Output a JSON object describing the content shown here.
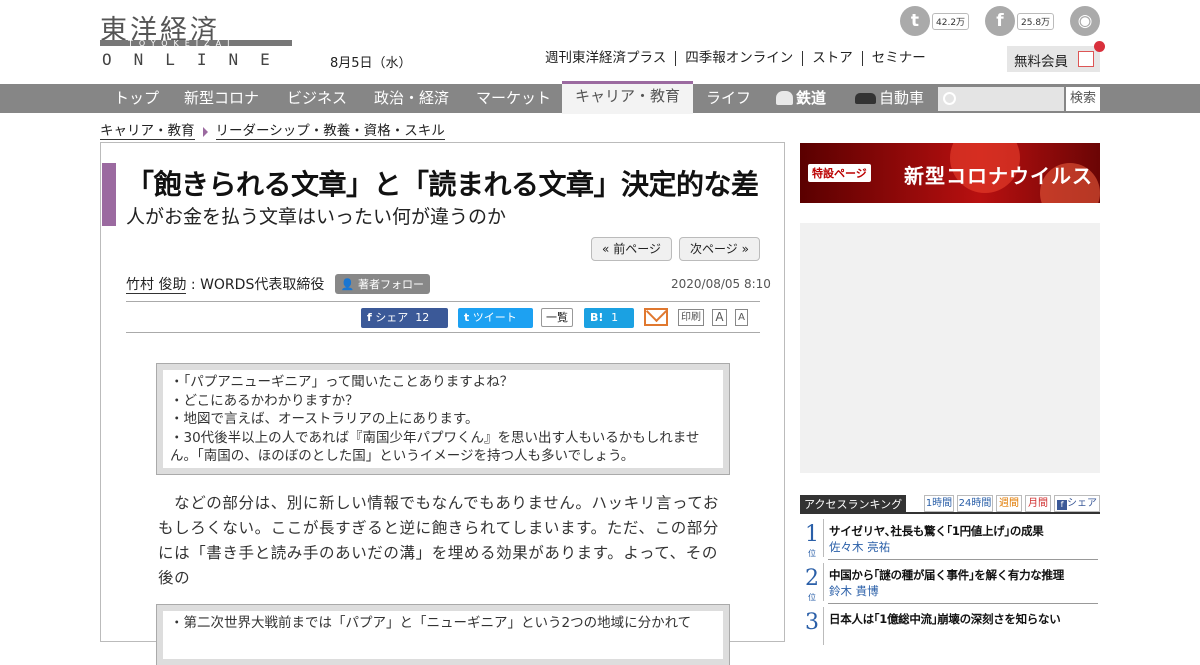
{
  "logo": {
    "jp": "東洋経済",
    "sub": "TOYOKEIZAI",
    "en": "ONLINE"
  },
  "date": "8月5日（水）",
  "social": {
    "twitter_count": "42.2万",
    "facebook_count": "25.8万"
  },
  "top_links": [
    "週刊東洋経済プラス",
    "四季報オンライン",
    "ストア",
    "セミナー"
  ],
  "member_label": "無料会員",
  "nav": {
    "items": [
      "トップ",
      "新型コロナ",
      "ビジネス",
      "政治・経済",
      "マーケット",
      "キャリア・教育",
      "ライフ",
      "鉄道",
      "自動車"
    ],
    "active": "キャリア・教育",
    "search_button": "検索"
  },
  "breadcrumb": [
    "キャリア・教育",
    "リーダーシップ・教養・資格・スキル"
  ],
  "article": {
    "title": "「飽きられる文章」と「読まれる文章」決定的な差",
    "subtitle": "人がお金を払う文章はいったい何が違うのか",
    "prev": "« 前ページ",
    "next": "次ページ »",
    "author_name": "竹村 俊助",
    "author_role": " : WORDS代表取締役",
    "follow_label": "著者フォロー",
    "pubdate": "2020/08/05 8:10",
    "share_fb": "シェア",
    "share_fb_count": "12",
    "share_tw": "ツイート",
    "list_label": "一覧",
    "hatena": "B!",
    "hatena_count": "1",
    "print_label": "印刷",
    "font_a": "A",
    "font_a2": "A",
    "quote1": [
      "・「パプアニューギニア」って聞いたことありますよね？",
      "・どこにあるかわかりますか？",
      "・地図で言えば、オーストラリアの上にあります。",
      "・30代後半以上の人であれば『南国少年パプワくん』を思い出す人もいるかもしれません。「南国の、ほのぼのとした国」というイメージを持つ人も多いでしょう。"
    ],
    "body": "　などの部分は、別に新しい情報でもなんでもありません。ハッキリ言っておもしろくない。ここが長すぎると逆に飽きられてしまいます。ただ、この部分には「書き手と読み手のあいだの溝」を埋める効果があります。よって、その後の",
    "quote2": "・第二次世界大戦前までは「パプア」と「ニューギニア」という2つの地域に分かれて"
  },
  "banner": {
    "tag": "特設ページ",
    "text": "新型コロナウイルス"
  },
  "ranking": {
    "title": "アクセスランキング",
    "tabs": [
      "1時間",
      "24時間",
      "週間",
      "月間",
      "シェア"
    ],
    "rank_suffix": "位",
    "items": [
      {
        "rank": "1",
        "title": "サイゼリヤ､社長も驚く｢1円値上げ｣の成果",
        "author": "佐々木 亮祐"
      },
      {
        "rank": "2",
        "title": "中国から｢謎の種が届く事件｣を解く有力な推理",
        "author": "鈴木 貴博"
      },
      {
        "rank": "3",
        "title": "日本人は｢1億総中流｣崩壊の深刻さを知らない",
        "author": ""
      }
    ]
  },
  "colors": {
    "accent": "#9b6aa0",
    "nav": "#868686",
    "facebook": "#3b5998",
    "twitter": "#1da1f2",
    "rank": "#2a5fa8"
  }
}
